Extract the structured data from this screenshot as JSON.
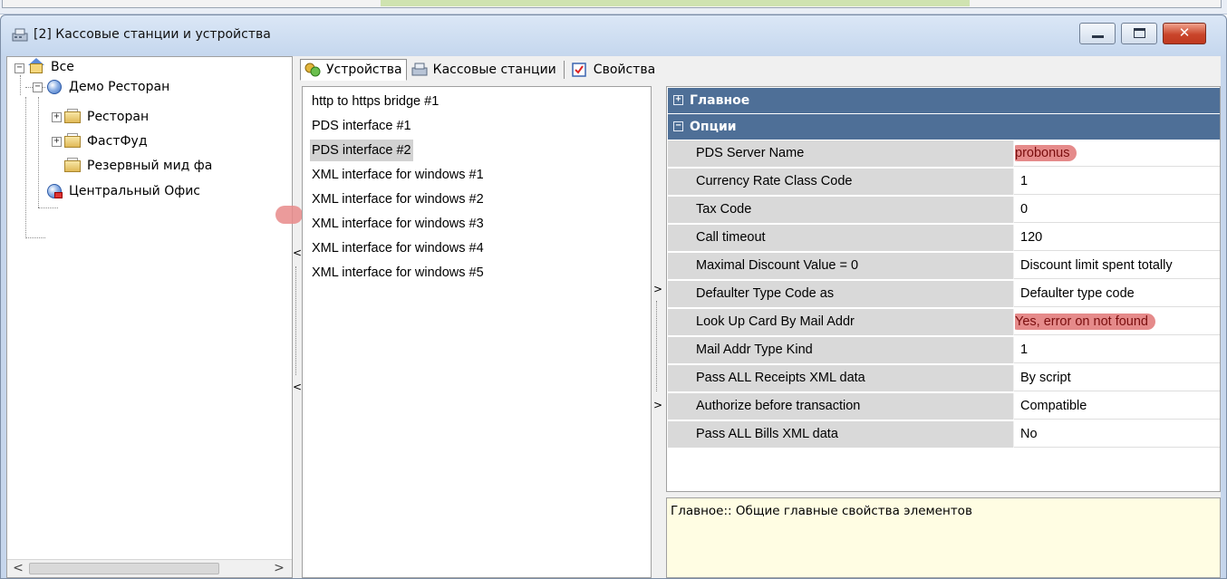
{
  "window": {
    "title": "[2] Кассовые станции и устройства",
    "buttons": {
      "minimize": "–",
      "maximize": "□",
      "close": "✕"
    }
  },
  "tree": {
    "root": "Все",
    "restaurant": "Демо Ресторан",
    "children": [
      "Ресторан",
      "ФастФуд",
      "Резервный мид фа"
    ],
    "office": "Центральный Офис",
    "scroll_left": "<",
    "scroll_right": ">"
  },
  "tabs": {
    "devices": "Устройства",
    "stations": "Кассовые станции",
    "properties": "Свойства"
  },
  "devices": [
    "http to https bridge #1",
    "PDS interface #1",
    "PDS interface #2",
    "XML interface for windows #1",
    "XML interface for windows #2",
    "XML interface for windows #3",
    "XML interface for windows #4",
    "XML interface for windows #5"
  ],
  "selected_device": "PDS interface #2",
  "properties": {
    "categories": {
      "main": "Главное",
      "options": "Опции"
    },
    "rows": [
      {
        "name": "PDS Server Name",
        "value": "probonus",
        "highlight": true
      },
      {
        "name": "Currency Rate Class Code",
        "value": "1"
      },
      {
        "name": "Tax Code",
        "value": "0"
      },
      {
        "name": "Call timeout",
        "value": "120"
      },
      {
        "name": "Maximal Discount Value = 0",
        "value": "Discount limit spent totally"
      },
      {
        "name": "Defaulter Type Code as",
        "value": "Defaulter type code"
      },
      {
        "name": "Look Up Card By Mail Addr",
        "value": "Yes, error on not found",
        "highlight": true
      },
      {
        "name": "Mail Addr Type Kind",
        "value": "1"
      },
      {
        "name": "Pass ALL Receipts XML data",
        "value": "By script"
      },
      {
        "name": "Authorize before transaction",
        "value": "Compatible"
      },
      {
        "name": "Pass ALL Bills XML data",
        "value": "No"
      }
    ]
  },
  "description": "Главное:: Общие главные свойства элементов",
  "splitters": {
    "left_arrow": "<",
    "right_arrow": ">"
  },
  "colors": {
    "category": "#4e6f97",
    "highlight": "#e58a8a",
    "selected": "#d2d2d2",
    "desc_bg": "#fffde3"
  }
}
